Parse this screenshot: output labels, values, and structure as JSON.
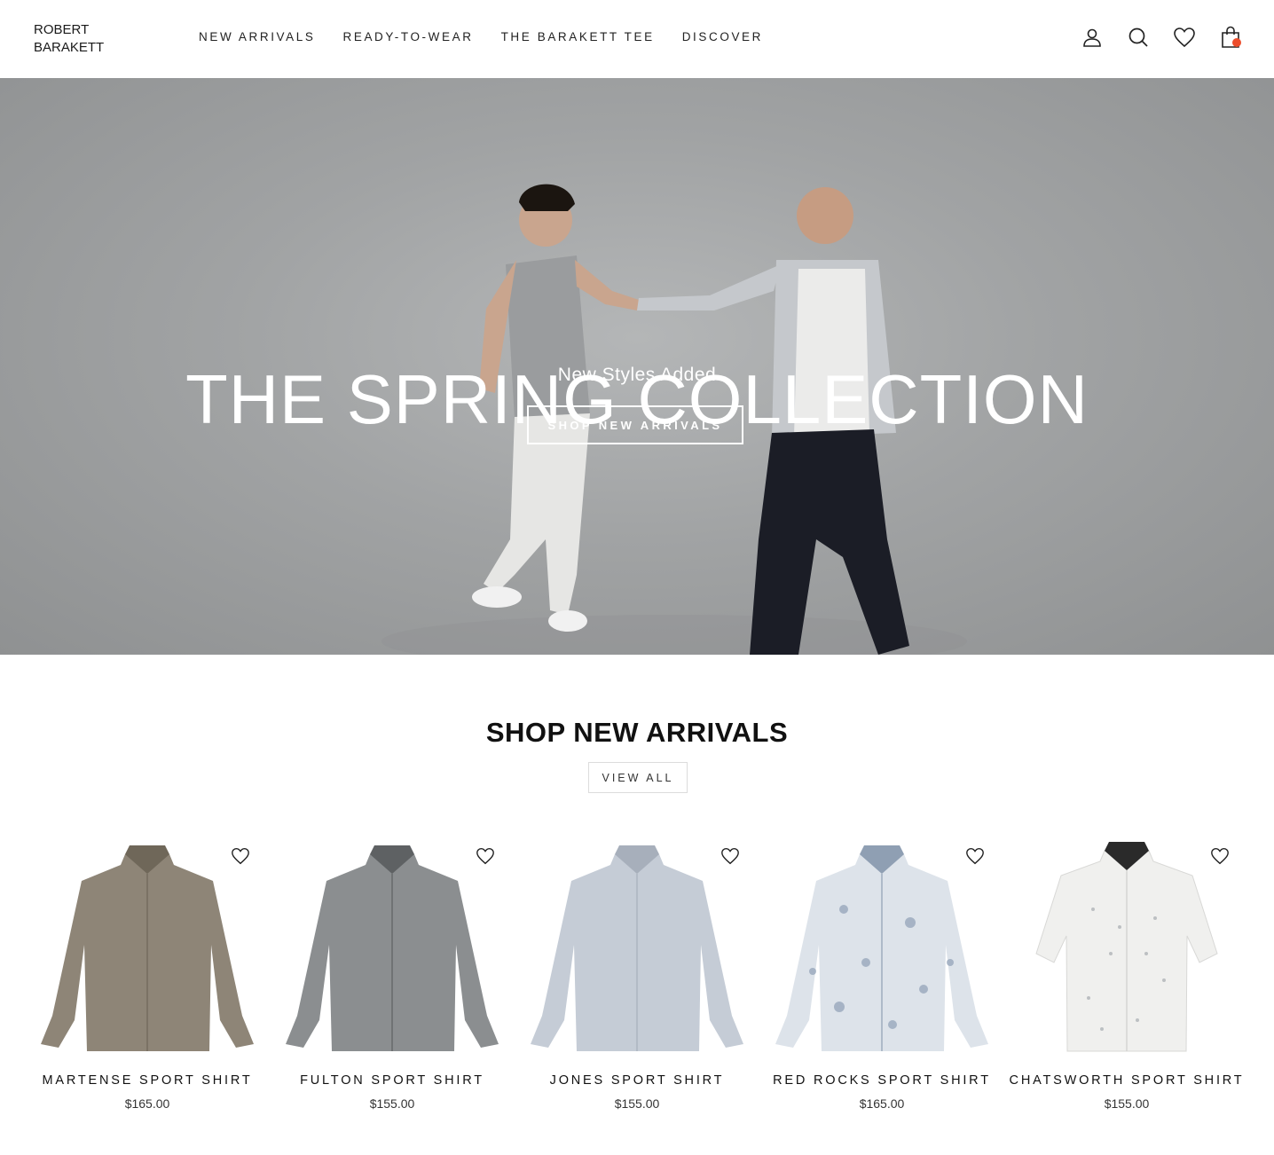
{
  "brand": {
    "line1": "ROBERT",
    "line2": "BARAKETT"
  },
  "nav": [
    {
      "label": "NEW ARRIVALS"
    },
    {
      "label": "READY-TO-WEAR"
    },
    {
      "label": "THE BARAKETT TEE"
    },
    {
      "label": "DISCOVER"
    }
  ],
  "header_icons": [
    "account-icon",
    "search-icon",
    "wishlist-heart-icon",
    "shopping-bag-icon"
  ],
  "colors": {
    "accent": "#ec4d2c",
    "text": "#111111",
    "hero_bg": "#a1a3a4"
  },
  "hero": {
    "title": "THE SPRING COLLECTION",
    "subtitle": "New Styles Added",
    "cta": "SHOP NEW ARRIVALS"
  },
  "section": {
    "title": "SHOP NEW ARRIVALS",
    "view_all": "VIEW ALL"
  },
  "products": [
    {
      "name": "MARTENSE SPORT SHIRT",
      "price": "$165.00",
      "color": "#8e8577"
    },
    {
      "name": "FULTON SPORT SHIRT",
      "price": "$155.00",
      "color": "#8b8e90"
    },
    {
      "name": "JONES SPORT SHIRT",
      "price": "$155.00",
      "color": "#c5ccd6"
    },
    {
      "name": "RED ROCKS SPORT SHIRT",
      "price": "$165.00",
      "color": "#dde3ea"
    },
    {
      "name": "CHATSWORTH SPORT SHIRT",
      "price": "$155.00",
      "color": "#f0f0ee"
    }
  ]
}
